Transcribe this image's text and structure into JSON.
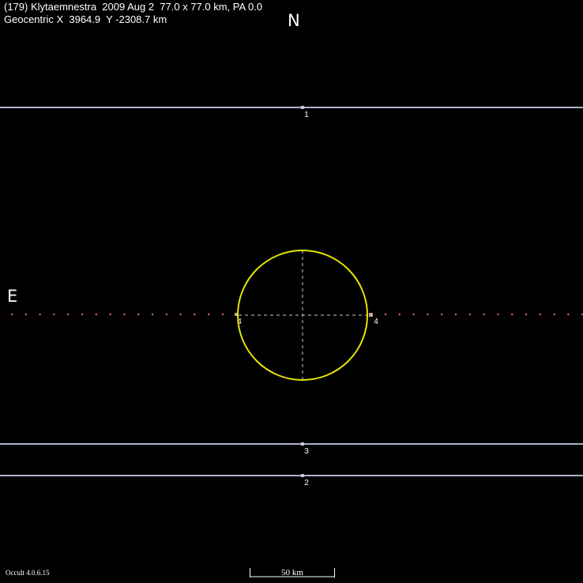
{
  "header": {
    "line1": "(179) Klytaemnestra  2009 Aug 2  77.0 x 77.0 km, PA 0.0",
    "line2": "Geocentric X  3964.9  Y -2308.7 km"
  },
  "compass": {
    "north": "N",
    "east": "E"
  },
  "chords": [
    {
      "label": "1",
      "color": "#aab4c8"
    },
    {
      "label": "3",
      "color": "#aab4c8"
    },
    {
      "label": "2",
      "color": "#aab4c8"
    }
  ],
  "miss_chord": {
    "label": "4",
    "color": "#ff6e6e"
  },
  "asteroid": {
    "diameter_km": 77.0,
    "outline_color": "#e6e600"
  },
  "scale_bar": {
    "label": "50 km",
    "length_km": 50
  },
  "footer": {
    "version": "Occult 4.0.6.15"
  }
}
